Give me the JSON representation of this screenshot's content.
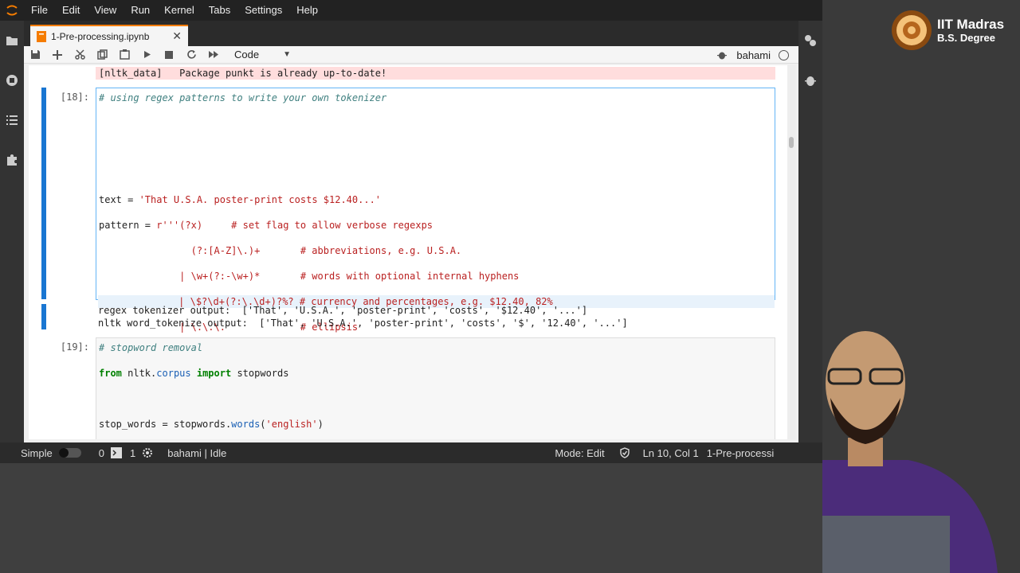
{
  "menu": [
    "File",
    "Edit",
    "View",
    "Run",
    "Kernel",
    "Tabs",
    "Settings",
    "Help"
  ],
  "tab": {
    "title": "1-Pre-processing.ipynb",
    "close": "✕"
  },
  "toolbar": {
    "cell_type": "Code",
    "kernel": "bahami"
  },
  "cells": {
    "prev_output": "[nltk_data]   Package punkt is already up-to-date!",
    "c18": {
      "prompt": "[18]:",
      "out1": "regex tokenizer output:  ['That', 'U.S.A.', 'poster-print', 'costs', '$12.40', '...']",
      "out2": "nltk word_tokenize output:  ['That', 'U.S.A.', 'poster-print', 'costs', '$', '12.40', '...']"
    },
    "c19": {
      "prompt": "[19]:"
    }
  },
  "status": {
    "mode_label": "Simple",
    "count_a": "0",
    "count_b": "1",
    "kernel_status": "bahami | Idle",
    "mode": "Mode: Edit",
    "cursor": "Ln 10, Col 1",
    "file": "1-Pre-processi"
  },
  "branding": {
    "title": "IIT Madras",
    "subtitle": "B.S. Degree"
  }
}
